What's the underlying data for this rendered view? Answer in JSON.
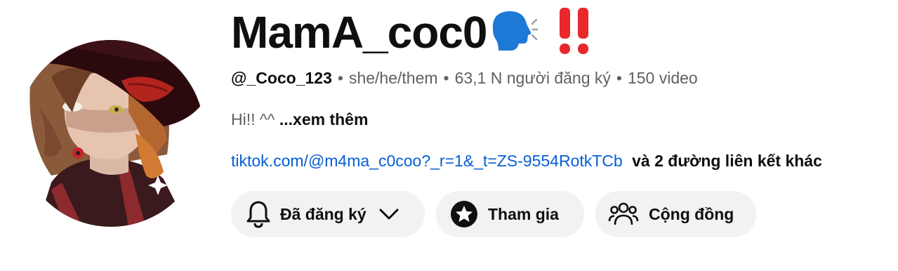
{
  "channel": {
    "name": "MamA_coc0",
    "name_emojis": [
      "speaking-head-emoji",
      "double-exclamation-emoji"
    ],
    "handle": "@_Coco_123",
    "pronouns": "she/he/them",
    "subscribers": "63,1 N người đăng ký",
    "videos": "150 video",
    "separator": "•",
    "description": "Hi!! ^^",
    "description_more": "...xem thêm",
    "link": "tiktok.com/@m4ma_c0coo?_r=1&_t=ZS-9554RotkTCb",
    "link_more": "và 2 đường liên kết khác"
  },
  "buttons": {
    "subscribed_label": "Đã đăng ký",
    "join_label": "Tham gia",
    "community_label": "Cộng đồng"
  },
  "icons": {
    "subscribed": "bell-icon",
    "subscribed_menu": "chevron-down-icon",
    "join": "star-badge-icon",
    "community": "people-icon"
  },
  "colors": {
    "link": "#065fd4",
    "button_bg": "#f2f2f2",
    "secondary_text": "#606060",
    "emoji_blue": "#1e78d6",
    "emoji_red": "#e8282b"
  }
}
